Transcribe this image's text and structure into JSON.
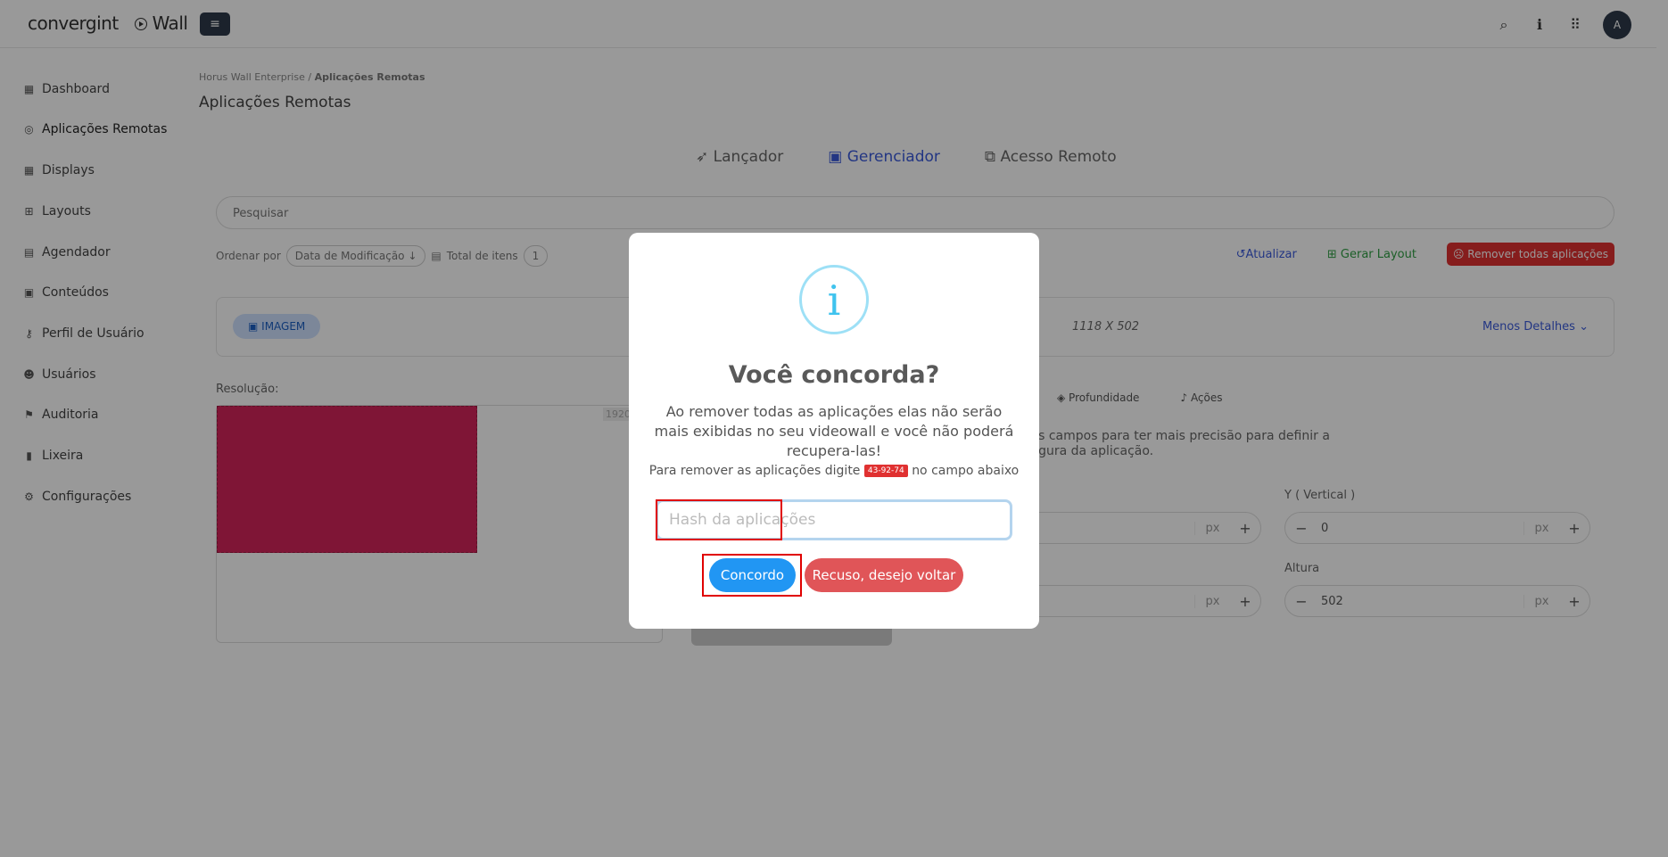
{
  "topbar": {
    "brand": "convergint",
    "product": "Wall",
    "avatar_initial": "A",
    "icons": [
      "search-icon",
      "info-icon",
      "apps-grid-icon",
      "menu-icon",
      "play-circle-icon"
    ]
  },
  "sidebar": {
    "items": [
      {
        "label": "Dashboard",
        "icon": "dashboard-icon"
      },
      {
        "label": "Aplicações Remotas",
        "icon": "satellite-icon"
      },
      {
        "label": "Displays",
        "icon": "grid-icon"
      },
      {
        "label": "Layouts",
        "icon": "layout-icon"
      },
      {
        "label": "Agendador",
        "icon": "calendar-icon"
      },
      {
        "label": "Conteúdos",
        "icon": "image-icon"
      },
      {
        "label": "Perfil de Usuário",
        "icon": "key-icon"
      },
      {
        "label": "Usuários",
        "icon": "users-icon"
      },
      {
        "label": "Auditoria",
        "icon": "flag-icon"
      },
      {
        "label": "Lixeira",
        "icon": "trash-icon"
      },
      {
        "label": "Configurações",
        "icon": "gear-icon"
      }
    ]
  },
  "breadcrumb": {
    "root": "Horus Wall Enterprise",
    "sep": "/",
    "current": "Aplicações Remotas"
  },
  "page_title": "Aplicações Remotas",
  "tabs": [
    "Lançador",
    "Gerenciador",
    "Acesso Remoto"
  ],
  "search": {
    "placeholder": "Pesquisar"
  },
  "sort": {
    "label": "Ordenar por",
    "value": "Data de Modificação ↓",
    "total_label": "Total de itens",
    "total": "1"
  },
  "actions": {
    "refresh": "Atualizar",
    "layout": "Gerar Layout",
    "remove_all": "Remover todas aplicações"
  },
  "item": {
    "type": "IMAGEM",
    "dims": "1118 X 502",
    "less_details": "Menos Detalhes"
  },
  "resolution": {
    "label": "Resolução:",
    "tag": "1920"
  },
  "sub_tabs": [
    "Profundidade",
    "Ações"
  ],
  "help": {
    "line1": "tes campos para ter mais precisão para definir a",
    "line2": "argura da aplicação."
  },
  "fields": {
    "y_label": "Y ( Vertical )",
    "y_value": "0",
    "x_value": "",
    "width_value": "",
    "height_label": "Altura",
    "height_value": "502",
    "unit": "px",
    "minus": "−",
    "plus": "+"
  },
  "modal": {
    "title": "Você concorda?",
    "text": "Ao remover todas as aplicações elas não serão mais exibidas no seu videowall e você não poderá recupera-las!",
    "small_before": "Para remover as aplicações digite",
    "hash": "43-92-74",
    "small_after": "no campo abaixo",
    "input_placeholder": "Hash da aplicações",
    "agree": "Concordo",
    "refuse": "Recuso, desejo voltar",
    "info_glyph": "i"
  }
}
